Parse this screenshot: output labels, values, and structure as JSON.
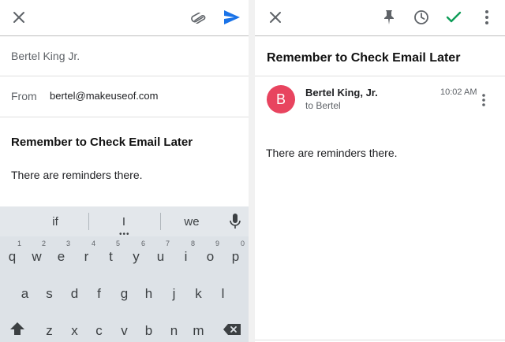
{
  "compose": {
    "to_value": "Bertel King Jr.",
    "from_label": "From",
    "from_value": "bertel@makeuseof.com",
    "subject": "Remember to Check Email Later",
    "body": "There are reminders there."
  },
  "keyboard": {
    "suggestions": [
      "if",
      "I",
      "we"
    ],
    "row1": [
      {
        "ch": "q",
        "hint": "1"
      },
      {
        "ch": "w",
        "hint": "2"
      },
      {
        "ch": "e",
        "hint": "3"
      },
      {
        "ch": "r",
        "hint": "4"
      },
      {
        "ch": "t",
        "hint": "5"
      },
      {
        "ch": "y",
        "hint": "6"
      },
      {
        "ch": "u",
        "hint": "7"
      },
      {
        "ch": "i",
        "hint": "8"
      },
      {
        "ch": "o",
        "hint": "9"
      },
      {
        "ch": "p",
        "hint": "0"
      }
    ],
    "row2": [
      "a",
      "s",
      "d",
      "f",
      "g",
      "h",
      "j",
      "k",
      "l"
    ],
    "row3": [
      "z",
      "x",
      "c",
      "v",
      "b",
      "n",
      "m"
    ]
  },
  "message": {
    "title": "Remember to Check Email Later",
    "avatar_letter": "B",
    "avatar_color": "#e8445f",
    "sender": "Bertel King, Jr.",
    "recipient": "to Bertel",
    "time": "10:02 AM",
    "body": "There are reminders there."
  },
  "colors": {
    "send_accent": "#1a73e8",
    "done_check": "#0f9d58"
  },
  "icons": {
    "compose_toolbar": [
      "close-icon",
      "attach-icon",
      "send-icon"
    ],
    "message_toolbar": [
      "close-icon",
      "pin-icon",
      "snooze-clock-icon",
      "done-check-icon",
      "more-vert-icon"
    ]
  }
}
